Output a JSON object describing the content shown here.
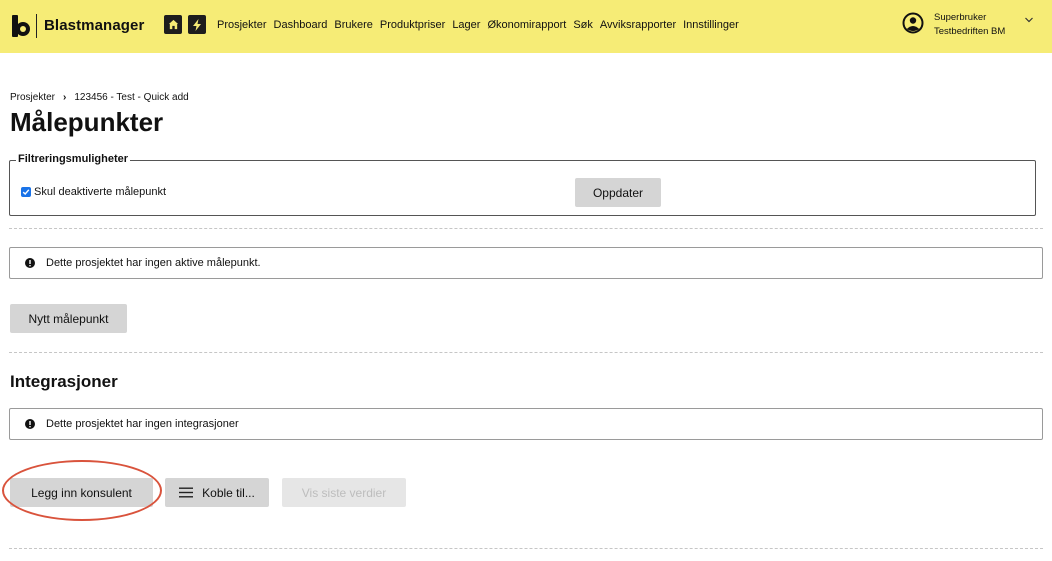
{
  "app": {
    "brand": "Blastmanager",
    "nav": [
      "Prosjekter",
      "Dashboard",
      "Brukere",
      "Produktpriser",
      "Lager",
      "Økonomirapport",
      "Søk",
      "Avviksrapporter",
      "Innstillinger"
    ],
    "user": {
      "name": "Superbruker",
      "company": "Testbedriften BM"
    }
  },
  "breadcrumb": {
    "root": "Prosjekter",
    "current": "123456 - Test - Quick add"
  },
  "page": {
    "title": "Målepunkter"
  },
  "filter": {
    "legend": "Filtreringsmuligheter",
    "hide_deactivated_label": "Skul deaktiverte målepunkt",
    "hide_deactivated_checked": true,
    "update_label": "Oppdater"
  },
  "measurement_points": {
    "empty_message": "Dette prosjektet har ingen aktive målepunkt.",
    "new_button": "Nytt målepunkt"
  },
  "integrations": {
    "title": "Integrasjoner",
    "empty_message": "Dette prosjektet har ingen integrasjoner",
    "add_consultant_button": "Legg inn konsulent",
    "connect_button": "Koble til...",
    "show_latest_button": "Vis siste verdier"
  },
  "colors": {
    "topbar": "#f6ec76",
    "annotation": "#d9533c",
    "button": "#d5d5d5"
  }
}
